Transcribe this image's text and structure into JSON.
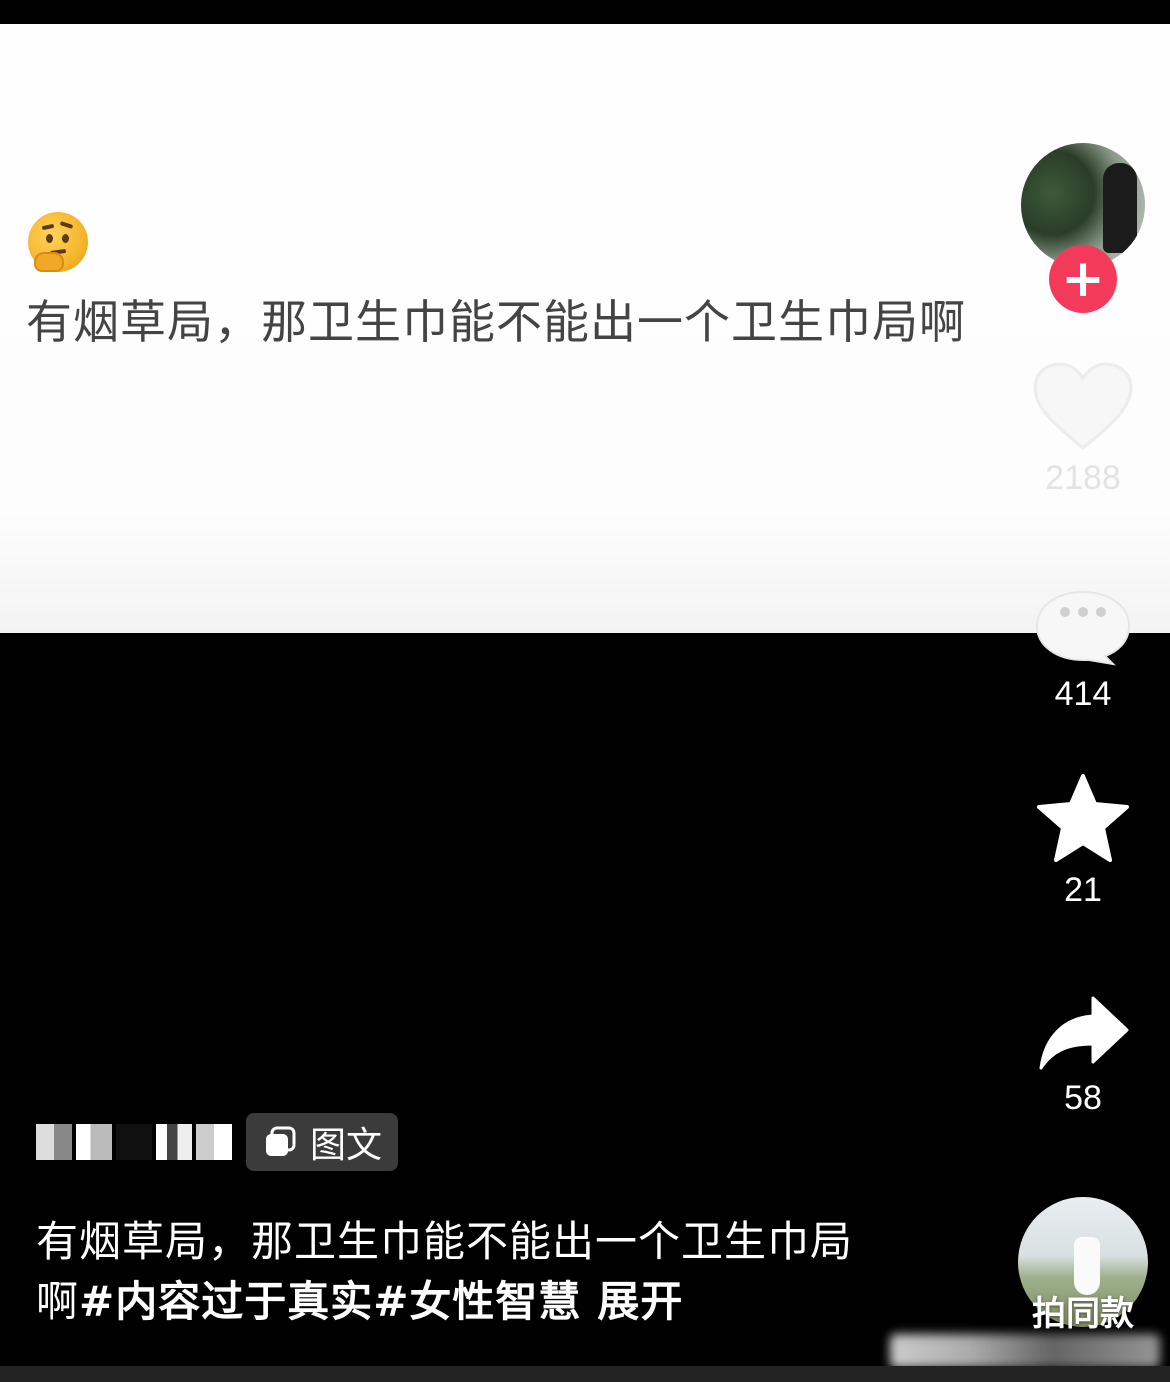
{
  "post_card": {
    "emoji_name": "thinking-face-icon",
    "text": "有烟草局，那卫生巾能不能出一个卫生巾局啊"
  },
  "actions": {
    "like_count": "2188",
    "comment_count": "414",
    "favorite_count": "21",
    "share_count": "58",
    "follow_icon": "plus-icon"
  },
  "author": {
    "tag_label": "图文"
  },
  "description": {
    "text": "有烟草局，那卫生巾能不能出一个卫生巾局啊",
    "hashtag_1": "#内容过于真实",
    "hashtag_2": "#女性智慧",
    "expand_label": "展开"
  },
  "same_style": {
    "label": "拍同款"
  },
  "colors": {
    "follow_red": "#f43a5a",
    "background": "#000000",
    "card_background": "#fefefe",
    "tag_pill": "#3b3b3b"
  }
}
